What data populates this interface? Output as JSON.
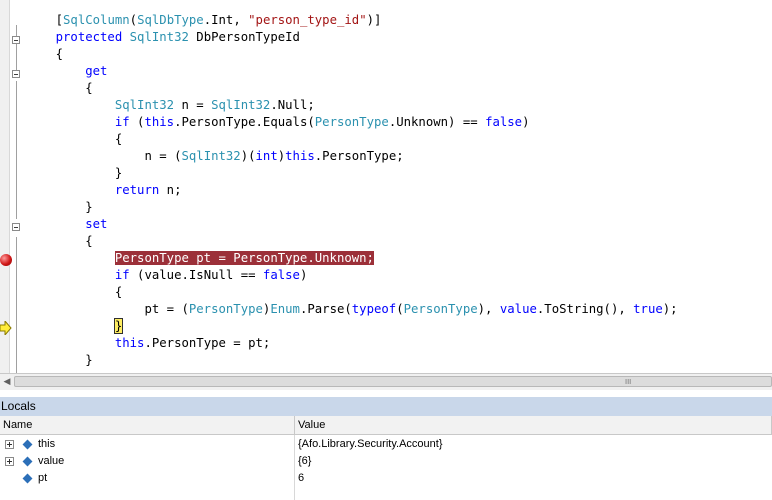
{
  "editor": {
    "lines": [
      [
        [
          "tx",
          "    ["
        ],
        [
          "ty",
          "SqlColumn"
        ],
        [
          "tx",
          "("
        ],
        [
          "ty",
          "SqlDbType"
        ],
        [
          "tx",
          ".Int, "
        ],
        [
          "str",
          "\"person_type_id\""
        ],
        [
          "tx",
          ")]"
        ]
      ],
      [
        [
          "kw",
          "    protected "
        ],
        [
          "ty",
          "SqlInt32"
        ],
        [
          "tx",
          " DbPersonTypeId"
        ]
      ],
      [
        [
          "tx",
          "    {"
        ]
      ],
      [
        [
          "kw",
          "        get"
        ]
      ],
      [
        [
          "tx",
          "        {"
        ]
      ],
      [
        [
          "ty",
          "            SqlInt32"
        ],
        [
          "tx",
          " n = "
        ],
        [
          "ty",
          "SqlInt32"
        ],
        [
          "tx",
          ".Null;"
        ]
      ],
      [
        [
          "kw",
          "            if"
        ],
        [
          "tx",
          " ("
        ],
        [
          "kw",
          "this"
        ],
        [
          "tx",
          ".PersonType.Equals("
        ],
        [
          "ty",
          "PersonType"
        ],
        [
          "tx",
          ".Unknown) == "
        ],
        [
          "kw",
          "false"
        ],
        [
          "tx",
          ")"
        ]
      ],
      [
        [
          "tx",
          "            {"
        ]
      ],
      [
        [
          "tx",
          "                n = ("
        ],
        [
          "ty",
          "SqlInt32"
        ],
        [
          "tx",
          ")("
        ],
        [
          "kw",
          "int"
        ],
        [
          "tx",
          ")"
        ],
        [
          "kw",
          "this"
        ],
        [
          "tx",
          ".PersonType;"
        ]
      ],
      [
        [
          "tx",
          "            }"
        ]
      ],
      [
        [
          "kw",
          "            return"
        ],
        [
          "tx",
          " n;"
        ]
      ],
      [
        [
          "tx",
          "        }"
        ]
      ],
      [
        [
          "kw",
          "        set"
        ]
      ],
      [
        [
          "tx",
          "        {"
        ]
      ],
      [
        [
          "tx",
          "            "
        ],
        [
          "hl",
          "PersonType pt = PersonType.Unknown;"
        ]
      ],
      [
        [
          "kw",
          "            if"
        ],
        [
          "tx",
          " (value.IsNull == "
        ],
        [
          "kw",
          "false"
        ],
        [
          "tx",
          ")"
        ]
      ],
      [
        [
          "tx",
          "            {"
        ]
      ],
      [
        [
          "tx",
          "                pt = ("
        ],
        [
          "ty",
          "PersonType"
        ],
        [
          "tx",
          ")"
        ],
        [
          "ty",
          "Enum"
        ],
        [
          "tx",
          ".Parse("
        ],
        [
          "kw",
          "typeof"
        ],
        [
          "tx",
          "("
        ],
        [
          "ty",
          "PersonType"
        ],
        [
          "tx",
          "), "
        ],
        [
          "kw",
          "value"
        ],
        [
          "tx",
          ".ToString(), "
        ],
        [
          "kw",
          "true"
        ],
        [
          "tx",
          ");"
        ]
      ],
      [
        [
          "tx",
          "            "
        ],
        [
          "cur",
          "}"
        ]
      ],
      [
        [
          "kw",
          "            this"
        ],
        [
          "tx",
          ".PersonType = pt;"
        ]
      ],
      [
        [
          "tx",
          "        }"
        ]
      ]
    ]
  },
  "scrollbar": {
    "grip": "III"
  },
  "locals": {
    "title": "Locals",
    "columns": {
      "name": "Name",
      "value": "Value"
    },
    "rows": [
      {
        "name": "this",
        "value": "{Afo.Library.Security.Account}",
        "expandable": true
      },
      {
        "name": "value",
        "value": "{6}",
        "expandable": true
      },
      {
        "name": "pt",
        "value": "6",
        "expandable": false
      }
    ]
  },
  "colors": {
    "keyword": "#0000ff",
    "type": "#2b91af",
    "string": "#a31515",
    "breakpoint_highlight": "#9c3039",
    "panel_title": "#c9d7ea"
  }
}
